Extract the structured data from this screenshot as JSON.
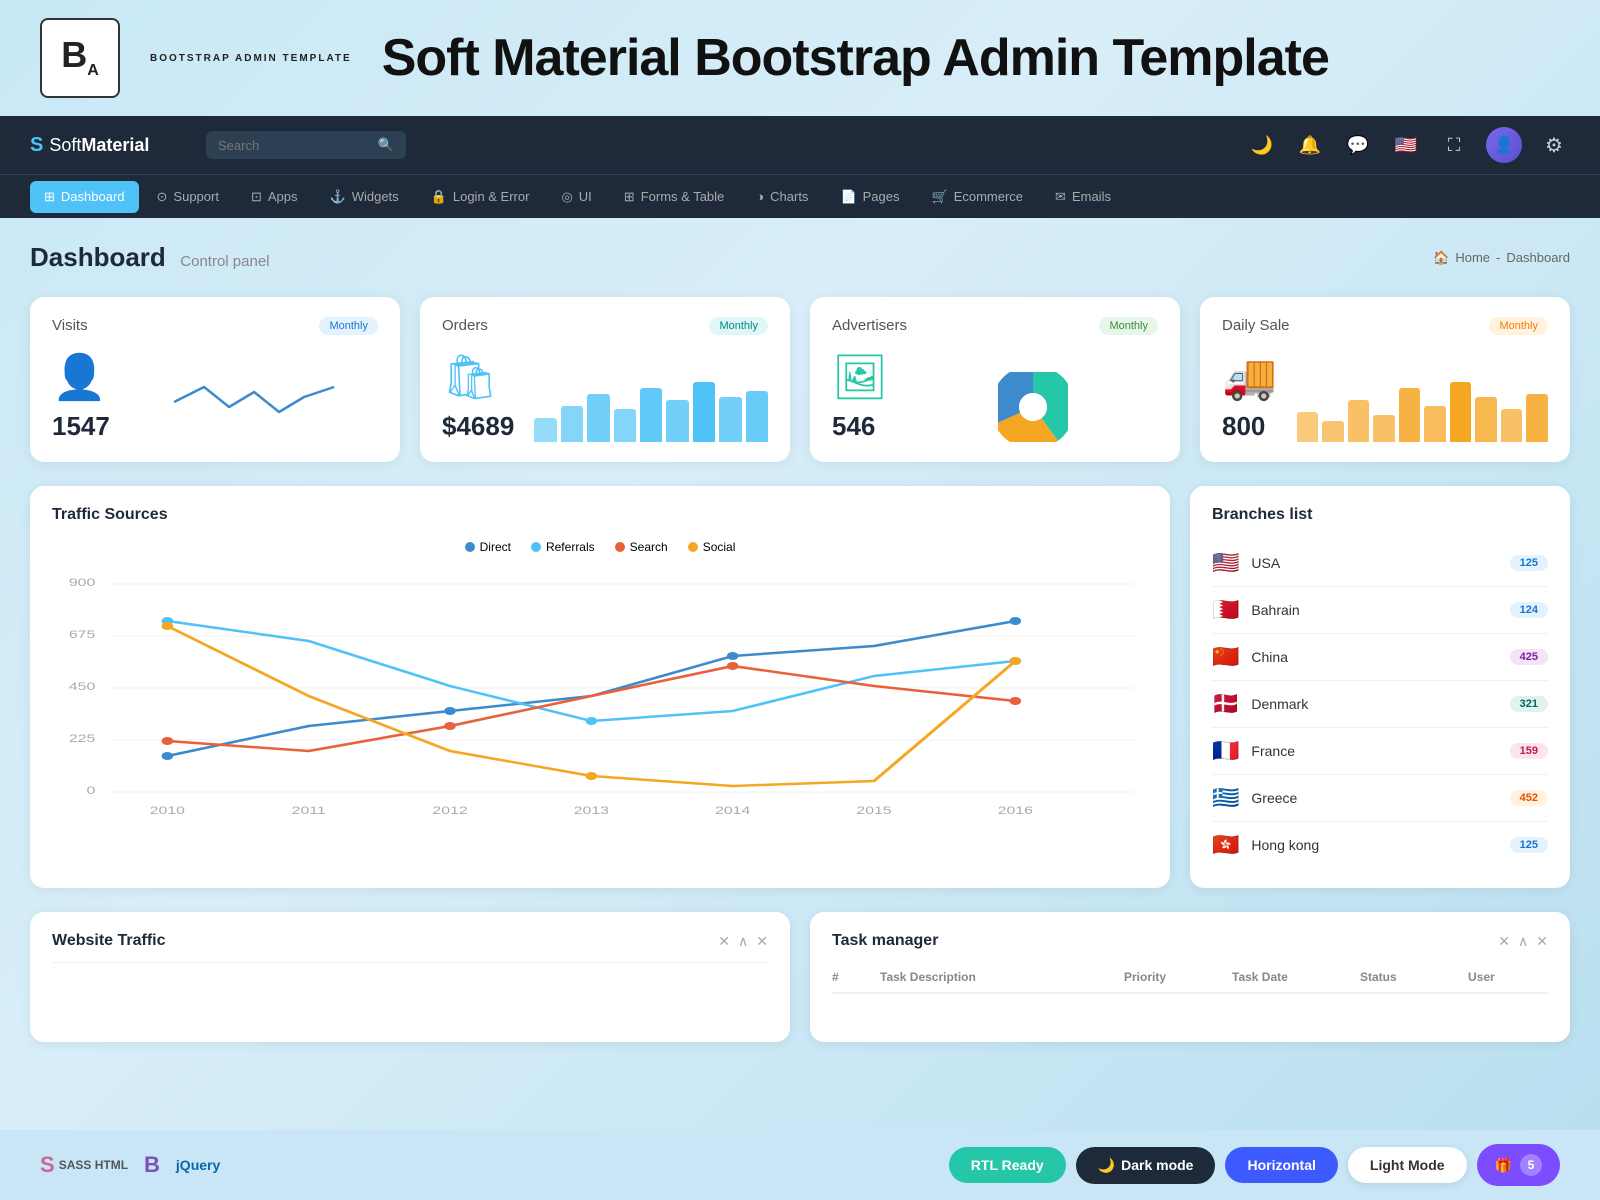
{
  "banner": {
    "title": "Soft Material Bootstrap Admin Template",
    "logo_letter": "B",
    "logo_sub": "BOOTSTRAP\nADMIN TEMPLATE"
  },
  "navbar": {
    "brand": "SoftMaterial",
    "brand_soft": "Soft",
    "brand_material": "Material",
    "search_placeholder": "Search",
    "icons": [
      "moon",
      "bell",
      "chat",
      "flag",
      "fullscreen",
      "avatar",
      "settings"
    ]
  },
  "nav_menu": {
    "items": [
      {
        "label": "Dashboard",
        "icon": "⊞",
        "active": true
      },
      {
        "label": "Support",
        "icon": "⊙"
      },
      {
        "label": "Apps",
        "icon": "⊡"
      },
      {
        "label": "Widgets",
        "icon": "⚓"
      },
      {
        "label": "Login & Error",
        "icon": "🔒"
      },
      {
        "label": "UI",
        "icon": "◎"
      },
      {
        "label": "Forms & Table",
        "icon": "⊞"
      },
      {
        "label": "Charts",
        "icon": "◑"
      },
      {
        "label": "Pages",
        "icon": "📄"
      },
      {
        "label": "Ecommerce",
        "icon": "🛒"
      },
      {
        "label": "Emails",
        "icon": "✉"
      }
    ]
  },
  "page": {
    "title": "Dashboard",
    "subtitle": "Control panel",
    "breadcrumb_home": "Home",
    "breadcrumb_current": "Dashboard"
  },
  "stats": [
    {
      "label": "Visits",
      "badge": "Monthly",
      "badge_class": "badge-blue",
      "value": "1547",
      "icon": "👤",
      "icon_color": "#3d8bcd",
      "type": "line"
    },
    {
      "label": "Orders",
      "badge": "Monthly",
      "badge_class": "badge-teal",
      "value": "$4689",
      "icon": "🛍",
      "icon_color": "#4fc3f7",
      "type": "bar",
      "bar_color": "#4fc3f7"
    },
    {
      "label": "Advertisers",
      "badge": "Monthly",
      "badge_class": "badge-green",
      "value": "546",
      "icon": "🖼",
      "icon_color": "#26c6a8",
      "type": "pie"
    },
    {
      "label": "Daily Sale",
      "badge": "Monthly",
      "badge_class": "badge-orange",
      "value": "800",
      "icon": "🚚",
      "icon_color": "#f5a623",
      "type": "bar",
      "bar_color": "#f5a623"
    }
  ],
  "traffic": {
    "title": "Traffic Sources",
    "legend": [
      {
        "label": "Direct",
        "color": "#3d8bcd"
      },
      {
        "label": "Referrals",
        "color": "#4fc3f7"
      },
      {
        "label": "Search",
        "color": "#e8613a"
      },
      {
        "label": "Social",
        "color": "#f5a623"
      }
    ],
    "y_labels": [
      "900",
      "675",
      "450",
      "225",
      "0"
    ],
    "x_labels": [
      "2010",
      "2011",
      "2012",
      "2013",
      "2014",
      "2015",
      "2016"
    ]
  },
  "branches": {
    "title": "Branches list",
    "items": [
      {
        "country": "USA",
        "flag": "🇺🇸",
        "count": "125",
        "badge": "bb-blue"
      },
      {
        "country": "Bahrain",
        "flag": "🇧🇭",
        "count": "124",
        "badge": "bb-blue"
      },
      {
        "country": "China",
        "flag": "🇨🇳",
        "count": "425",
        "badge": "bb-purple"
      },
      {
        "country": "Denmark",
        "flag": "🇩🇰",
        "count": "321",
        "badge": "bb-teal"
      },
      {
        "country": "France",
        "flag": "🇫🇷",
        "count": "159",
        "badge": "bb-pink"
      },
      {
        "country": "Greece",
        "flag": "🇬🇷",
        "count": "452",
        "badge": "bb-orange"
      },
      {
        "country": "Hong kong",
        "flag": "🇭🇰",
        "count": "125",
        "badge": "bb-blue"
      }
    ]
  },
  "website_traffic": {
    "title": "Website Traffic",
    "controls": [
      "✕",
      "∧",
      "✕"
    ]
  },
  "task_manager": {
    "title": "Task manager",
    "controls": [
      "✕",
      "∧",
      "✕"
    ],
    "columns": [
      "#",
      "Task Description",
      "Priority",
      "Task Date",
      "Status",
      "User"
    ]
  },
  "footer": {
    "techs": [
      "SASS HTML",
      "Bootstrap",
      "jQuery"
    ],
    "buttons": [
      {
        "label": "RTL Ready",
        "class": "btn-rtl"
      },
      {
        "label": "Dark mode",
        "class": "btn-dark",
        "icon": "🌙"
      },
      {
        "label": "Horizontal",
        "class": "btn-horizontal"
      },
      {
        "label": "Light Mode",
        "class": "btn-light"
      }
    ],
    "badge_count": "5"
  }
}
